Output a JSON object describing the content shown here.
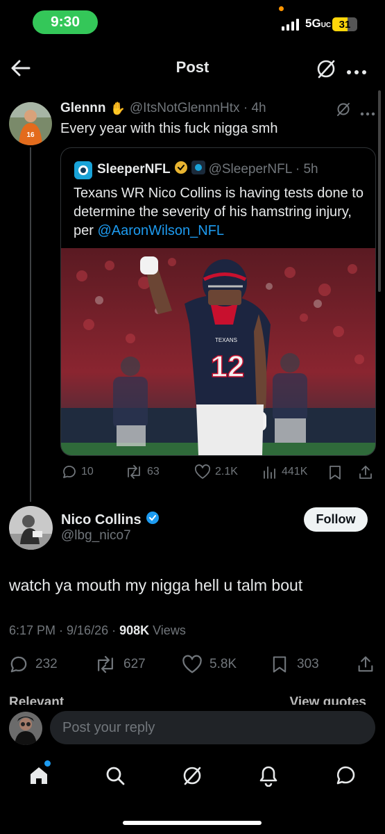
{
  "status_bar": {
    "time": "9:30",
    "network": "5G",
    "battery": "31"
  },
  "header": {
    "title": "Post"
  },
  "reply_tweet": {
    "display_name": "Glennn",
    "handle_time": "@ItsNotGlennnHtx · 4h",
    "text": "Every year with this fuck nigga smh"
  },
  "quoted_tweet": {
    "display_name": "SleeperNFL",
    "handle_time": "@SleeperNFL · 5h",
    "text_before": "Texans WR Nico Collins is having tests done to determine the severity of his hamstring injury, per ",
    "mention": "@AaronWilson_NFL",
    "jersey_number": "12",
    "jersey_team": "TEXANS"
  },
  "reply_tweet_stats": {
    "replies": "10",
    "reposts": "63",
    "likes": "2.1K",
    "views": "441K"
  },
  "main_tweet": {
    "display_name": "Nico Collins",
    "handle": "@lbg_nico7",
    "follow_label": "Follow",
    "text": "watch ya mouth my nigga hell u talm bout",
    "time": "6:17 PM · 9/16/26 · ",
    "views_count": "908K",
    "views_label": " Views"
  },
  "main_tweet_stats": {
    "replies": "232",
    "reposts": "627",
    "likes": "5.8K",
    "bookmarks": "303"
  },
  "cutoff_text": {
    "left": "Relevant",
    "right": "View quotes"
  },
  "reply_bar": {
    "placeholder": "Post your reply"
  },
  "colors": {
    "accent": "#1d9bf0",
    "background": "#000000",
    "muted": "#71767b",
    "status_green": "#34c759"
  },
  "icons": [
    "back-arrow-icon",
    "grok-icon",
    "more-icon",
    "comment-icon",
    "repost-icon",
    "like-icon",
    "views-icon",
    "bookmark-icon",
    "share-icon",
    "home-icon",
    "search-icon",
    "notifications-icon",
    "messages-icon",
    "verified-badge-icon"
  ]
}
